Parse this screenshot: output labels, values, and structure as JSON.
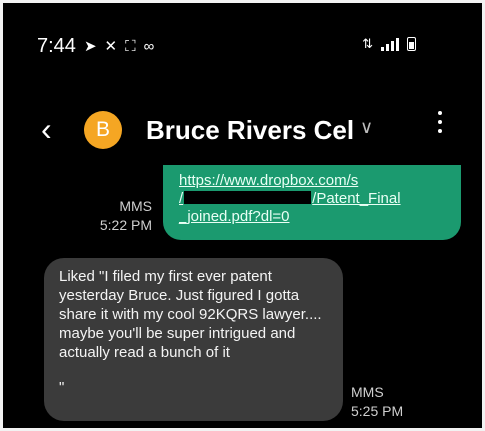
{
  "status_bar": {
    "time": "7:44",
    "left_icons": [
      "navigation-icon",
      "missed-call-icon",
      "screenshot-icon",
      "voicemail-icon"
    ],
    "right_icons": [
      "data-transfer-icon",
      "signal-icon",
      "battery-icon"
    ]
  },
  "header": {
    "avatar_letter": "B",
    "avatar_color": "#f5a623",
    "contact_name": "Bruce Rivers Cel"
  },
  "messages": [
    {
      "direction": "outgoing",
      "link_line1": "https://www.dropbox.com/s",
      "link_line2_start": "/",
      "link_line2_end": "/Patent_Final",
      "link_line3": "_joined.pdf?dl=0",
      "type_label": "MMS",
      "time": "5:22 PM",
      "bubble_color": "#1b9a6f"
    },
    {
      "direction": "incoming",
      "text": "Liked \"I filed my first ever patent yesterday Bruce. Just figured I gotta share it with my cool 92KQRS lawyer.... maybe you'll be super intrigued and actually read a bunch of it",
      "closing": "\"",
      "type_label": "MMS",
      "time": "5:25 PM",
      "bubble_color": "#3b3b3b"
    }
  ]
}
